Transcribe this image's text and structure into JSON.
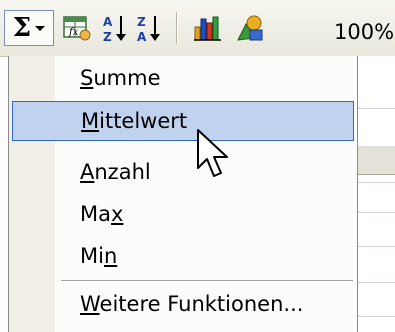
{
  "toolbar": {
    "sigma_label": "Σ",
    "zoom": "100%",
    "icons": [
      "autosum-sigma-icon",
      "dropdown-arrow-icon",
      "insert-function-icon",
      "sort-ascending-icon",
      "sort-descending-icon",
      "chart-wizard-icon",
      "drawing-icon"
    ]
  },
  "menu": {
    "items": [
      {
        "pre": "",
        "key": "S",
        "post": "umme"
      },
      {
        "pre": "",
        "key": "M",
        "post": "ittelwert"
      },
      {
        "pre": "",
        "key": "A",
        "post": "nzahl"
      },
      {
        "pre": "Ma",
        "key": "x",
        "post": ""
      },
      {
        "pre": "Mi",
        "key": "n",
        "post": ""
      },
      {
        "pre": "",
        "key": "W",
        "post": "eitere Funktionen..."
      }
    ],
    "highlighted_index": 1
  },
  "colors": {
    "highlight_bg": "#c1d2ee",
    "highlight_border": "#316ac5",
    "toolbar_bg": "#ece9d8"
  }
}
